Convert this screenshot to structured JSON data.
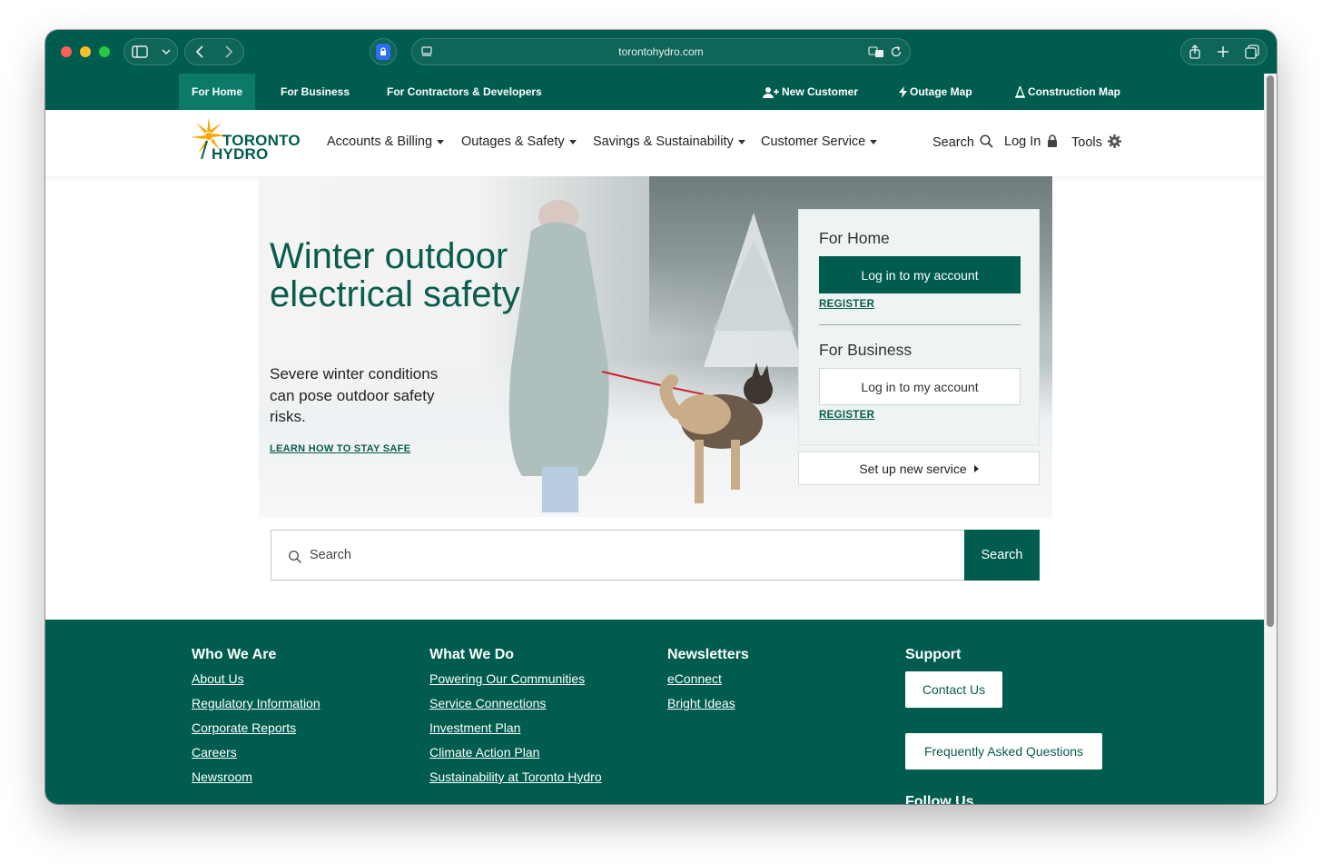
{
  "browser": {
    "url": "torontohydro.com"
  },
  "topnav": {
    "items": [
      {
        "label": "For Home"
      },
      {
        "label": "For Business"
      },
      {
        "label": "For Contractors & Developers"
      }
    ],
    "right": [
      {
        "label": "New Customer",
        "icon": "add-user-icon"
      },
      {
        "label": "Outage Map",
        "icon": "lightning-icon"
      },
      {
        "label": "Construction Map",
        "icon": "cone-icon"
      }
    ]
  },
  "logo": {
    "line1": "TORONTO",
    "line2": "HYDRO"
  },
  "mainnav": {
    "items": [
      {
        "label": "Accounts & Billing"
      },
      {
        "label": "Outages & Safety"
      },
      {
        "label": "Savings & Sustainability"
      },
      {
        "label": "Customer Service"
      }
    ],
    "search": "Search",
    "login": "Log In",
    "tools": "Tools"
  },
  "hero": {
    "title": "Winter outdoor electrical safety",
    "subtitle": "Severe winter conditions can pose outdoor safety risks.",
    "link": "LEARN HOW TO STAY SAFE"
  },
  "login_card": {
    "home_heading": "For Home",
    "home_button": "Log in to my account",
    "home_register": "REGISTER",
    "business_heading": "For Business",
    "business_button": "Log in to my account",
    "business_register": "REGISTER",
    "setup": "Set up new service"
  },
  "search": {
    "placeholder": "Search",
    "button": "Search"
  },
  "footer": {
    "col1": {
      "heading": "Who We Are",
      "links": [
        "About Us",
        "Regulatory Information",
        "Corporate Reports",
        "Careers",
        "Newsroom"
      ]
    },
    "col2": {
      "heading": "What We Do",
      "links": [
        "Powering Our Communities",
        "Service Connections",
        "Investment Plan",
        "Climate Action Plan",
        "Sustainability at Toronto Hydro"
      ]
    },
    "col3": {
      "heading": "Newsletters",
      "links": [
        "eConnect",
        "Bright Ideas"
      ]
    },
    "col4": {
      "heading": "Support",
      "contact": "Contact Us",
      "faq": "Frequently Asked Questions",
      "follow": "Follow Us"
    }
  },
  "colors": {
    "brand_green": "#005c4e",
    "accent_yellow": "#f5a800"
  }
}
